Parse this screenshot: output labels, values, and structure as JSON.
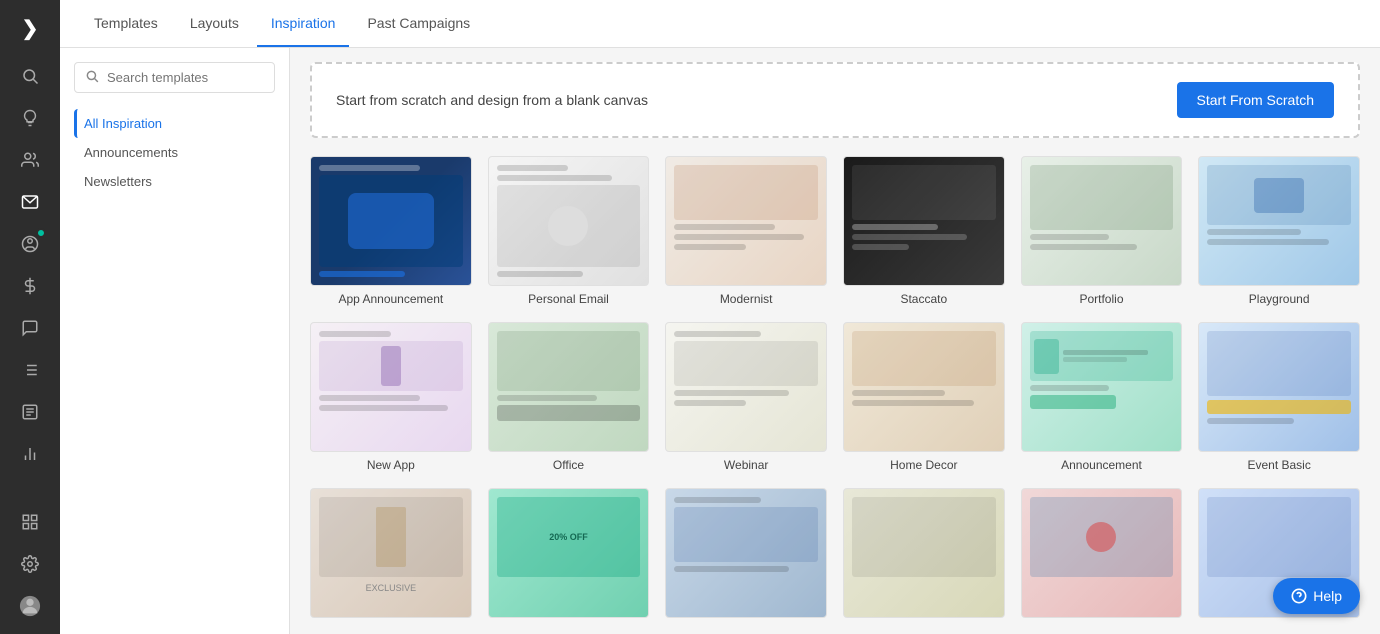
{
  "nav": {
    "tabs": [
      {
        "id": "templates",
        "label": "Templates",
        "active": false
      },
      {
        "id": "layouts",
        "label": "Layouts",
        "active": false
      },
      {
        "id": "inspiration",
        "label": "Inspiration",
        "active": true
      },
      {
        "id": "past-campaigns",
        "label": "Past Campaigns",
        "active": false
      }
    ]
  },
  "sidebar": {
    "icons": [
      {
        "name": "logo-icon",
        "symbol": "❯",
        "active": false
      },
      {
        "name": "search-nav-icon",
        "symbol": "🔍",
        "active": false
      },
      {
        "name": "lightbulb-icon",
        "symbol": "💡",
        "active": false
      },
      {
        "name": "people-icon",
        "symbol": "👥",
        "active": false
      },
      {
        "name": "mail-icon",
        "symbol": "✉",
        "active": false
      },
      {
        "name": "user-circle-icon",
        "symbol": "👤",
        "active": true,
        "badge": true
      },
      {
        "name": "dollar-icon",
        "symbol": "💲",
        "active": false
      },
      {
        "name": "chat-icon",
        "symbol": "💬",
        "active": false
      },
      {
        "name": "list-icon",
        "symbol": "☰",
        "active": false
      },
      {
        "name": "doc-icon",
        "symbol": "📄",
        "active": false
      },
      {
        "name": "chart-icon",
        "symbol": "📊",
        "active": false
      },
      {
        "name": "template-icon",
        "symbol": "⊞",
        "active": false
      },
      {
        "name": "settings-icon",
        "symbol": "⚙",
        "active": false
      },
      {
        "name": "avatar-icon",
        "symbol": "👤",
        "active": false
      }
    ]
  },
  "search": {
    "placeholder": "Search templates"
  },
  "filter": {
    "items": [
      {
        "id": "all",
        "label": "All Inspiration",
        "active": true
      },
      {
        "id": "announcements",
        "label": "Announcements",
        "active": false
      },
      {
        "id": "newsletters",
        "label": "Newsletters",
        "active": false
      }
    ]
  },
  "scratch_banner": {
    "text": "Start from scratch and design from a blank canvas",
    "button_label": "Start From Scratch"
  },
  "templates": [
    {
      "id": "app-announcement",
      "name": "App Announcement",
      "thumb_class": "thumb-app-announcement"
    },
    {
      "id": "personal-email",
      "name": "Personal Email",
      "thumb_class": "thumb-personal-email"
    },
    {
      "id": "modernist",
      "name": "Modernist",
      "thumb_class": "thumb-modernist"
    },
    {
      "id": "staccato",
      "name": "Staccato",
      "thumb_class": "thumb-staccato"
    },
    {
      "id": "portfolio",
      "name": "Portfolio",
      "thumb_class": "thumb-portfolio"
    },
    {
      "id": "playground",
      "name": "Playground",
      "thumb_class": "thumb-playground"
    },
    {
      "id": "new-app",
      "name": "New App",
      "thumb_class": "thumb-new-app"
    },
    {
      "id": "office",
      "name": "Office",
      "thumb_class": "thumb-office"
    },
    {
      "id": "webinar",
      "name": "Webinar",
      "thumb_class": "thumb-webinar"
    },
    {
      "id": "home-decor",
      "name": "Home Decor",
      "thumb_class": "thumb-home-decor"
    },
    {
      "id": "announcement",
      "name": "Announcement",
      "thumb_class": "thumb-announcement"
    },
    {
      "id": "event-basic",
      "name": "Event Basic",
      "thumb_class": "thumb-event-basic"
    },
    {
      "id": "row3-1",
      "name": "",
      "thumb_class": "thumb-row3-1"
    },
    {
      "id": "row3-2",
      "name": "",
      "thumb_class": "thumb-row3-2"
    },
    {
      "id": "row3-3",
      "name": "",
      "thumb_class": "thumb-row3-3"
    },
    {
      "id": "row3-4",
      "name": "",
      "thumb_class": "thumb-row3-4"
    },
    {
      "id": "row3-5",
      "name": "",
      "thumb_class": "thumb-row3-5"
    },
    {
      "id": "row3-6",
      "name": "",
      "thumb_class": "thumb-row3-6"
    }
  ],
  "help": {
    "label": "Help"
  }
}
